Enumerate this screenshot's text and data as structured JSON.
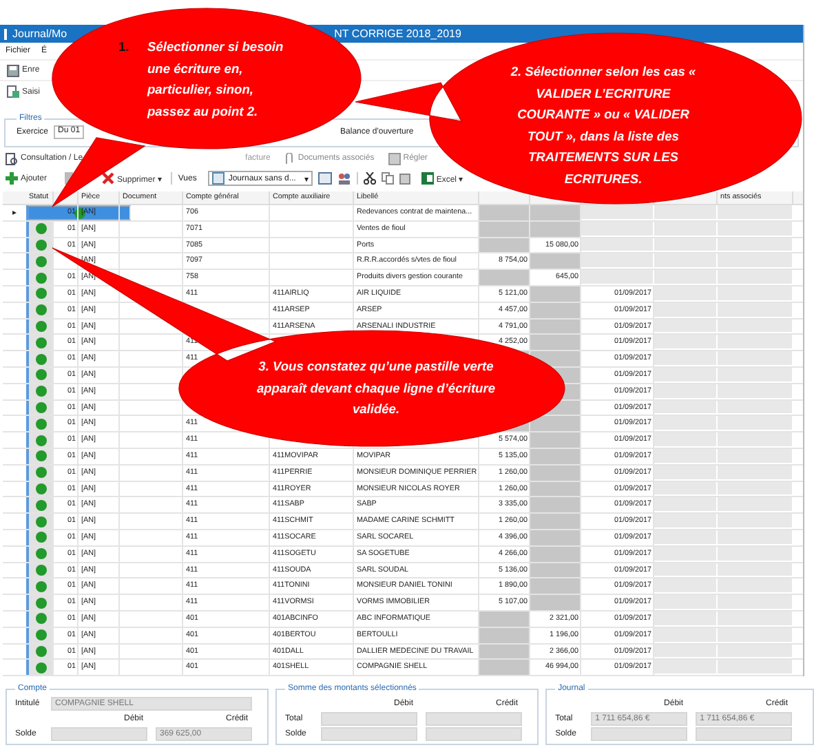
{
  "window": {
    "title_start": "Journal/Mo",
    "title_end": "NT CORRIGE 2018_2019"
  },
  "menu": [
    "Fichier",
    "É"
  ],
  "toolbar_top": [
    {
      "label": "Enre",
      "kind": "save"
    },
    {
      "label": "Saisi",
      "kind": "entry"
    }
  ],
  "filters": {
    "legend": "Filtres",
    "label": "Exercice",
    "value": "Du 01",
    "option": "Balance d'ouverture"
  },
  "toolbar_actions": [
    {
      "label": "Consultation / Le",
      "kind": "consult"
    },
    {
      "label": "facture",
      "kind": "invoice"
    },
    {
      "label": "Documents associés",
      "kind": "clip"
    },
    {
      "label": "Régler",
      "kind": "pay"
    }
  ],
  "toolbar_edit": {
    "add": "Ajouter",
    "delete": "Supprimer ▾",
    "views": "Vues",
    "view_select": "Journaux sans d...",
    "view_caret": "▾",
    "excel": "Excel ▾"
  },
  "table": {
    "row_indicator": "▸",
    "columns": [
      "Statut",
      null,
      "Pièce",
      "Document",
      "Compte général",
      "Compte auxiliaire",
      "Libellé",
      null,
      null,
      null,
      null,
      "nts associés"
    ],
    "rows": [
      {
        "selected": true,
        "validated": true,
        "journal": "01",
        "piece": "[AN]",
        "compte_general": "706",
        "libelle": "Redevances contrat de maintena..."
      },
      {
        "selected": false,
        "validated": true,
        "journal": "01",
        "piece": "[AN]",
        "compte_general": "7071",
        "libelle": "Ventes de fioul"
      },
      {
        "selected": false,
        "validated": true,
        "journal": "01",
        "piece": "[AN]",
        "compte_general": "7085",
        "libelle": "Ports",
        "credit": "15 080,00"
      },
      {
        "selected": false,
        "validated": true,
        "piece": "[AN]",
        "compte_general": "7097",
        "libelle": "R.R.R.accordés s/vtes de fioul",
        "debit": "8 754,00"
      },
      {
        "selected": false,
        "validated": true,
        "journal": "01",
        "piece": "[AN]",
        "compte_general": "758",
        "libelle": "Produits divers gestion courante",
        "credit": "645,00"
      },
      {
        "selected": false,
        "validated": true,
        "journal": "01",
        "piece": "[AN]",
        "compte_general": "411",
        "compte_auxiliaire": "411AIRLIQ",
        "libelle": "AIR LIQUIDE",
        "debit": "5 121,00",
        "date": "01/09/2017"
      },
      {
        "selected": false,
        "validated": true,
        "journal": "01",
        "piece": "[AN]",
        "compte_auxiliaire": "411ARSEP",
        "libelle": "ARSEP",
        "debit": "4 457,00",
        "date": "01/09/2017"
      },
      {
        "selected": false,
        "validated": true,
        "journal": "01",
        "piece": "[AN]",
        "compte_auxiliaire": "411ARSENA",
        "libelle": "ARSENALI INDUSTRIE",
        "debit": "4 791,00",
        "date": "01/09/2017"
      },
      {
        "selected": false,
        "validated": true,
        "journal": "01",
        "piece": "[AN]",
        "compte_general": "411",
        "debit": "4 252,00",
        "date": "01/09/2017"
      },
      {
        "selected": false,
        "validated": true,
        "journal": "01",
        "piece": "[AN]",
        "compte_general": "411",
        "date": "01/09/2017"
      },
      {
        "selected": false,
        "validated": true,
        "journal": "01",
        "piece": "[AN]",
        "date": "01/09/2017"
      },
      {
        "selected": false,
        "validated": true,
        "journal": "01",
        "piece": "[AN]",
        "date": "01/09/2017"
      },
      {
        "selected": false,
        "validated": true,
        "journal": "01",
        "piece": "[AN]",
        "date": "01/09/2017"
      },
      {
        "selected": false,
        "validated": true,
        "journal": "01",
        "piece": "[AN]",
        "compte_general": "411",
        "date": "01/09/2017"
      },
      {
        "selected": false,
        "validated": true,
        "journal": "01",
        "piece": "[AN]",
        "compte_general": "411",
        "debit": "5 574,00",
        "date": "01/09/2017"
      },
      {
        "selected": false,
        "validated": true,
        "journal": "01",
        "piece": "[AN]",
        "compte_general": "411",
        "compte_auxiliaire": "411MOVIPAR",
        "libelle": "MOVIPAR",
        "debit": "5 135,00",
        "date": "01/09/2017"
      },
      {
        "selected": false,
        "validated": true,
        "journal": "01",
        "piece": "[AN]",
        "compte_general": "411",
        "compte_auxiliaire": "411PERRIE",
        "libelle": "MONSIEUR DOMINIQUE PERRIER",
        "debit": "1 260,00",
        "date": "01/09/2017"
      },
      {
        "selected": false,
        "validated": true,
        "journal": "01",
        "piece": "[AN]",
        "compte_general": "411",
        "compte_auxiliaire": "411ROYER",
        "libelle": "MONSIEUR NICOLAS ROYER",
        "debit": "1 260,00",
        "date": "01/09/2017"
      },
      {
        "selected": false,
        "validated": true,
        "journal": "01",
        "piece": "[AN]",
        "compte_general": "411",
        "compte_auxiliaire": "411SABP",
        "libelle": "SABP",
        "debit": "3 335,00",
        "date": "01/09/2017"
      },
      {
        "selected": false,
        "validated": true,
        "journal": "01",
        "piece": "[AN]",
        "compte_general": "411",
        "compte_auxiliaire": "411SCHMIT",
        "libelle": "MADAME CARINE SCHMITT",
        "debit": "1 260,00",
        "date": "01/09/2017"
      },
      {
        "selected": false,
        "validated": true,
        "journal": "01",
        "piece": "[AN]",
        "compte_general": "411",
        "compte_auxiliaire": "411SOCARE",
        "libelle": "SARL SOCAREL",
        "debit": "4 396,00",
        "date": "01/09/2017"
      },
      {
        "selected": false,
        "validated": true,
        "journal": "01",
        "piece": "[AN]",
        "compte_general": "411",
        "compte_auxiliaire": "411SOGETU",
        "libelle": "SA SOGETUBE",
        "debit": "4 266,00",
        "date": "01/09/2017"
      },
      {
        "selected": false,
        "validated": true,
        "journal": "01",
        "piece": "[AN]",
        "compte_general": "411",
        "compte_auxiliaire": "411SOUDA",
        "libelle": "SARL SOUDAL",
        "debit": "5 136,00",
        "date": "01/09/2017"
      },
      {
        "selected": false,
        "validated": true,
        "journal": "01",
        "piece": "[AN]",
        "compte_general": "411",
        "compte_auxiliaire": "411TONINI",
        "libelle": "MONSIEUR DANIEL TONINI",
        "debit": "1 890,00",
        "date": "01/09/2017"
      },
      {
        "selected": false,
        "validated": true,
        "journal": "01",
        "piece": "[AN]",
        "compte_general": "411",
        "compte_auxiliaire": "411VORMSI",
        "libelle": "VORMS IMMOBILIER",
        "debit": "5 107,00",
        "date": "01/09/2017"
      },
      {
        "selected": false,
        "validated": true,
        "journal": "01",
        "piece": "[AN]",
        "compte_general": "401",
        "compte_auxiliaire": "401ABCINFO",
        "libelle": "ABC INFORMATIQUE",
        "credit": "2 321,00",
        "date": "01/09/2017"
      },
      {
        "selected": false,
        "validated": true,
        "journal": "01",
        "piece": "[AN]",
        "compte_general": "401",
        "compte_auxiliaire": "401BERTOU",
        "libelle": "BERTOULLI",
        "credit": "1 196,00",
        "date": "01/09/2017"
      },
      {
        "selected": false,
        "validated": true,
        "journal": "01",
        "piece": "[AN]",
        "compte_general": "401",
        "compte_auxiliaire": "401DALL",
        "libelle": "DALLIER MEDECINE DU TRAVAIL",
        "credit": "2 366,00",
        "date": "01/09/2017"
      },
      {
        "selected": false,
        "validated": true,
        "journal": "01",
        "piece": "[AN]",
        "compte_general": "401",
        "compte_auxiliaire": "401SHELL",
        "libelle": "COMPAGNIE SHELL",
        "credit": "46 994,00",
        "date": "01/09/2017"
      }
    ]
  },
  "panels": [
    {
      "legend": "Compte",
      "label": "Intitulé",
      "name": "COMPAGNIE SHELL",
      "debit_label": "Débit",
      "credit_label": "Crédit",
      "rows": [
        {
          "label": "Solde",
          "credit": "369 625,00"
        }
      ]
    },
    {
      "legend": "Somme des montants sélectionnés",
      "debit_label": "Débit",
      "credit_label": "Crédit",
      "rows": [
        {
          "label": "Total"
        },
        {
          "label": "Solde"
        }
      ]
    },
    {
      "legend": "Journal",
      "debit_label": "Débit",
      "credit_label": "Crédit",
      "rows": [
        {
          "label": "Total",
          "debit": "1 711 654,86 €",
          "credit": "1 711 654,86 €"
        },
        {
          "label": "Solde"
        }
      ]
    }
  ],
  "callouts": [
    {
      "number": "1.",
      "text": "Sélectionner si besoin une écriture en, particulier, sinon, passez au point 2."
    },
    {
      "text": "2. Sélectionner selon les cas « VALIDER L’ECRITURE COURANTE » ou « VALIDER TOUT », dans la liste des TRAITEMENTS SUR LES ECRITURES."
    },
    {
      "text": "3. Vous constatez qu’une pastille verte apparaît devant chaque ligne d’écriture validée."
    }
  ]
}
